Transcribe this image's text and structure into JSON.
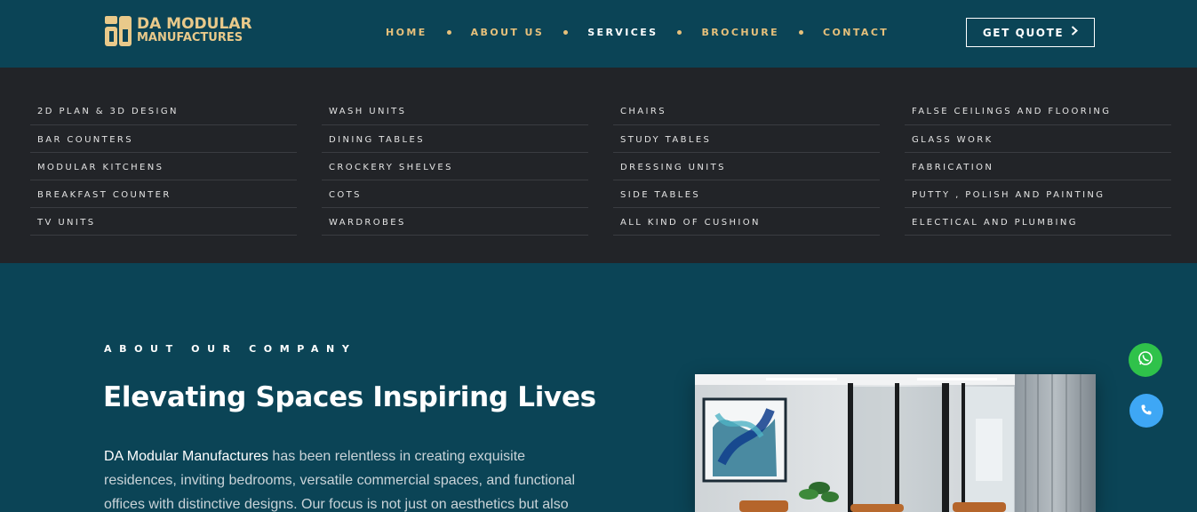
{
  "header": {
    "logo": {
      "line1": "DA MODULAR",
      "line2": "MANUFACTURES",
      "color": "#e9c98a"
    },
    "nav": [
      {
        "label": "HOME",
        "active": false
      },
      {
        "label": "ABOUT US",
        "active": false
      },
      {
        "label": "SERVICES",
        "active": true
      },
      {
        "label": "BROCHURE",
        "active": false
      },
      {
        "label": "CONTACT",
        "active": false
      }
    ],
    "quote_label": "GET QUOTE",
    "quote_icon": "chevron-right-icon"
  },
  "mega_menu": {
    "columns": [
      [
        "2D PLAN & 3D DESIGN",
        "BAR COUNTERS",
        "MODULAR KITCHENS",
        "BREAKFAST COUNTER",
        "TV UNITS"
      ],
      [
        "WASH UNITS",
        "DINING TABLES",
        "CROCKERY SHELVES",
        "COTS",
        "WARDROBES"
      ],
      [
        "CHAIRS",
        "STUDY TABLES",
        "DRESSING UNITS",
        "SIDE TABLES",
        "ALL KIND OF CUSHION"
      ],
      [
        "FALSE CEILINGS AND FLOORING",
        "GLASS WORK",
        "FABRICATION",
        "PUTTY , POLISH AND PAINTING",
        "ELECTICAL AND PLUMBING"
      ]
    ]
  },
  "about": {
    "eyebrow": "ABOUT OUR COMPANY",
    "headline": "Elevating Spaces Inspiring Lives",
    "brand": "DA Modular Manufactures",
    "body": " has been relentless in creating exquisite residences, inviting bedrooms, versatile commercial spaces, and functional offices with distinctive designs. Our focus is not just on aesthetics but also"
  },
  "floating": {
    "whatsapp_icon": "whatsapp-icon",
    "phone_icon": "phone-icon"
  },
  "colors": {
    "background": "#0b4456",
    "menu_background": "#222428",
    "accent_gold": "#e6c07b",
    "whatsapp_green": "#2fc24a",
    "phone_blue": "#3ea7f5"
  }
}
